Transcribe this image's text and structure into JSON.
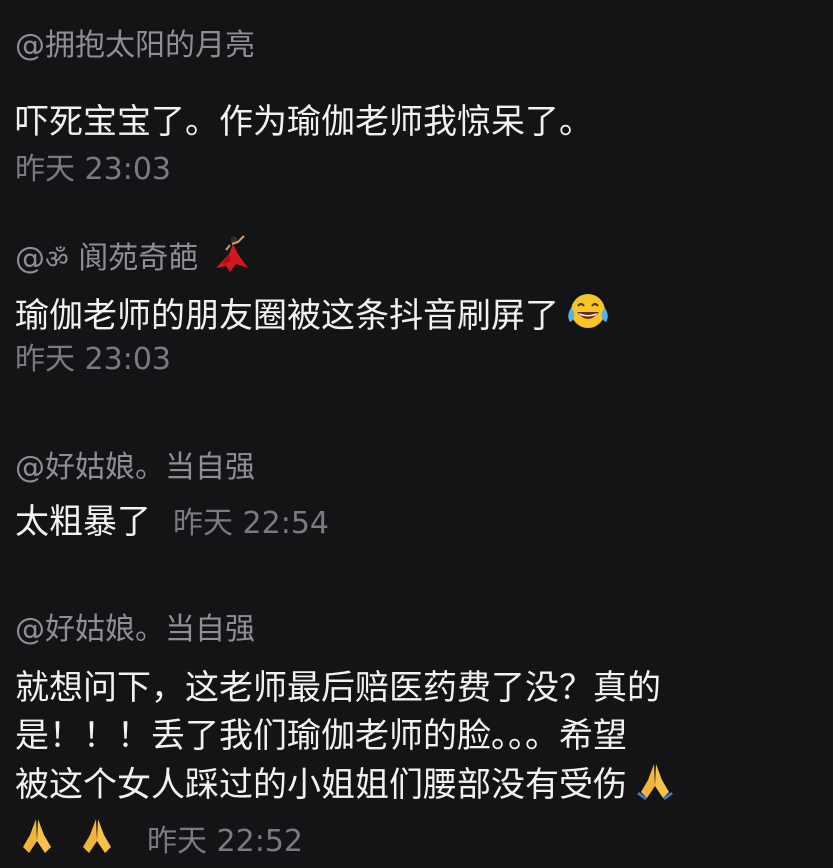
{
  "comments": [
    {
      "username": "@拥抱太阳的月亮",
      "text": "吓死宝宝了。作为瑜伽老师我惊呆了。",
      "time": "昨天 23:03"
    },
    {
      "username_prefix": "@",
      "username_symbol": "ॐ",
      "username_name": "阆苑奇葩",
      "username_emoji": "dancer-icon",
      "text": "瑜伽老师的朋友圈被这条抖音刷屏了",
      "text_emoji": "tears-of-joy-icon",
      "time": "昨天 23:03"
    },
    {
      "username": "@好姑娘。当自强",
      "text": "太粗暴了",
      "time": "昨天 22:54"
    },
    {
      "username": "@好姑娘。当自强",
      "lines": [
        "就想问下，这老师最后赔医药费了没？真的",
        "是！！！丢了我们瑜伽老师的脸。。。希望",
        "被这个女人踩过的小姐姐们腰部没有受伤"
      ],
      "line_emoji": "folded-hands-icon",
      "time": "昨天 22:52"
    }
  ],
  "colors": {
    "background": "#141416",
    "username": "#8e8e93",
    "text": "#f2f2f2",
    "timestamp": "#7a7a80"
  }
}
